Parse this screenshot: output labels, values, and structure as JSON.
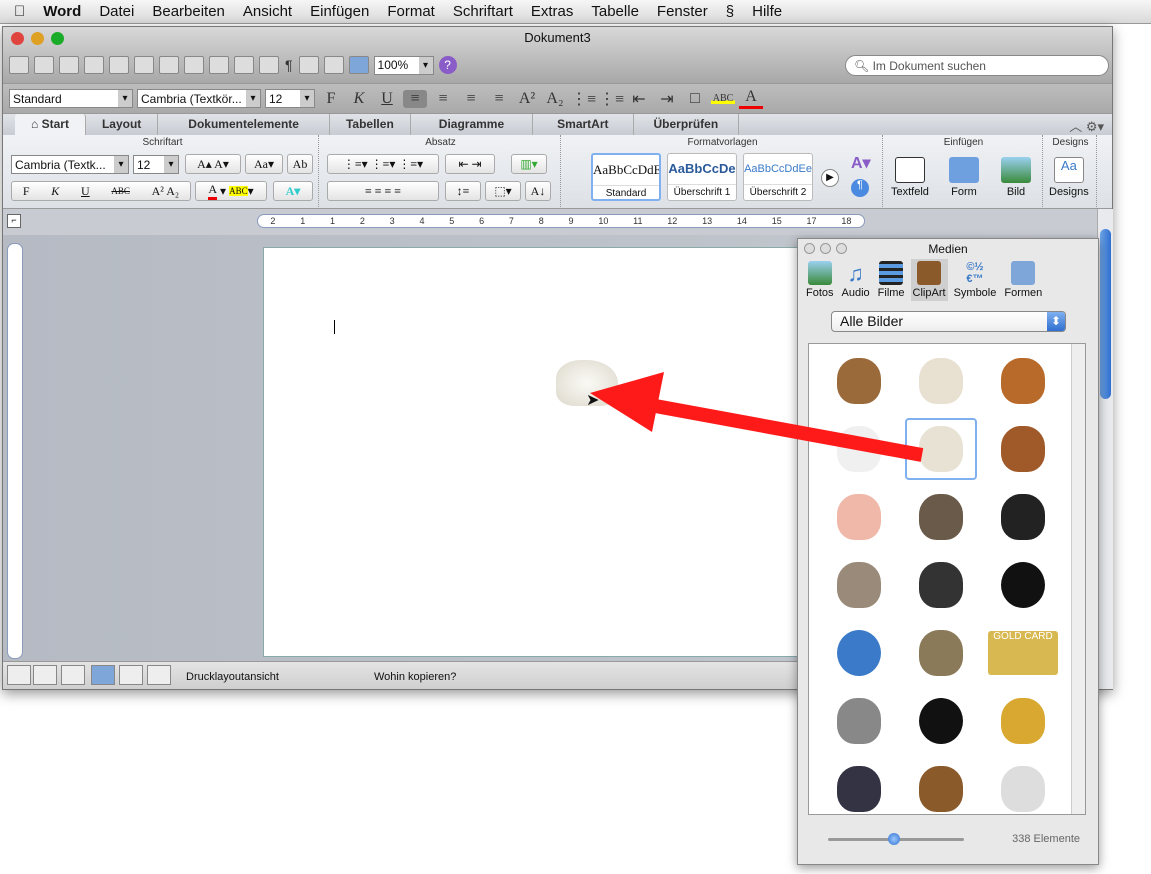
{
  "menubar": {
    "apple": "",
    "items": [
      "Word",
      "Datei",
      "Bearbeiten",
      "Ansicht",
      "Einfügen",
      "Format",
      "Schriftart",
      "Extras",
      "Tabelle",
      "Fenster",
      "Skript",
      "Hilfe"
    ]
  },
  "window": {
    "title": "Dokument3",
    "zoom": "100%",
    "search_placeholder": "Im Dokument suchen"
  },
  "formatbar": {
    "style": "Standard",
    "font": "Cambria (Textkör...",
    "size": "12",
    "bold": "F",
    "italic": "K",
    "underline": "U"
  },
  "tabs": [
    "Start",
    "Layout",
    "Dokumentelemente",
    "Tabellen",
    "Diagramme",
    "SmartArt",
    "Überprüfen"
  ],
  "ribbon": {
    "groups": {
      "schriftart": "Schriftart",
      "absatz": "Absatz",
      "formatvorlagen": "Formatvorlagen",
      "einfuegen": "Einfügen",
      "designs": "Designs"
    },
    "font": "Cambria (Textk...",
    "size": "12",
    "styles": [
      {
        "preview": "AaBbCcDdEe",
        "name": "Standard"
      },
      {
        "preview": "AaBbCcDe",
        "name": "Überschrift 1"
      },
      {
        "preview": "AaBbCcDdEe",
        "name": "Überschrift 2"
      }
    ],
    "insert": [
      "Textfeld",
      "Form",
      "Bild"
    ],
    "designs": "Designs"
  },
  "ruler": {
    "ticks": [
      "2",
      "1",
      "1",
      "2",
      "3",
      "4",
      "5",
      "6",
      "7",
      "8",
      "9",
      "10",
      "11",
      "12",
      "13",
      "14",
      "15",
      "17",
      "18"
    ]
  },
  "status": {
    "view": "Drucklayoutansicht",
    "hint": "Wohin kopieren?"
  },
  "media": {
    "title": "Medien",
    "tabs": [
      "Fotos",
      "Audio",
      "Filme",
      "ClipArt",
      "Symbole",
      "Formen"
    ],
    "active_tab": "ClipArt",
    "category": "Alle Bilder",
    "count": "338 Elemente",
    "clips": [
      "rabbit",
      "dog",
      "hen",
      "duck",
      "sheep",
      "horse",
      "pig",
      "donkey",
      "cow",
      "cat",
      "cash-drawer",
      "gauge",
      "globe",
      "coin-jar",
      "gold-card",
      "watering-can",
      "bomb",
      "gold-bar",
      "cash-tray",
      "hourglass",
      "keyboard"
    ],
    "gold_card_text": "GOLD CARD",
    "selected_clip": "sheep"
  },
  "colors": {
    "arrow": "#ff1a1a",
    "accent": "#2f6fd0"
  }
}
